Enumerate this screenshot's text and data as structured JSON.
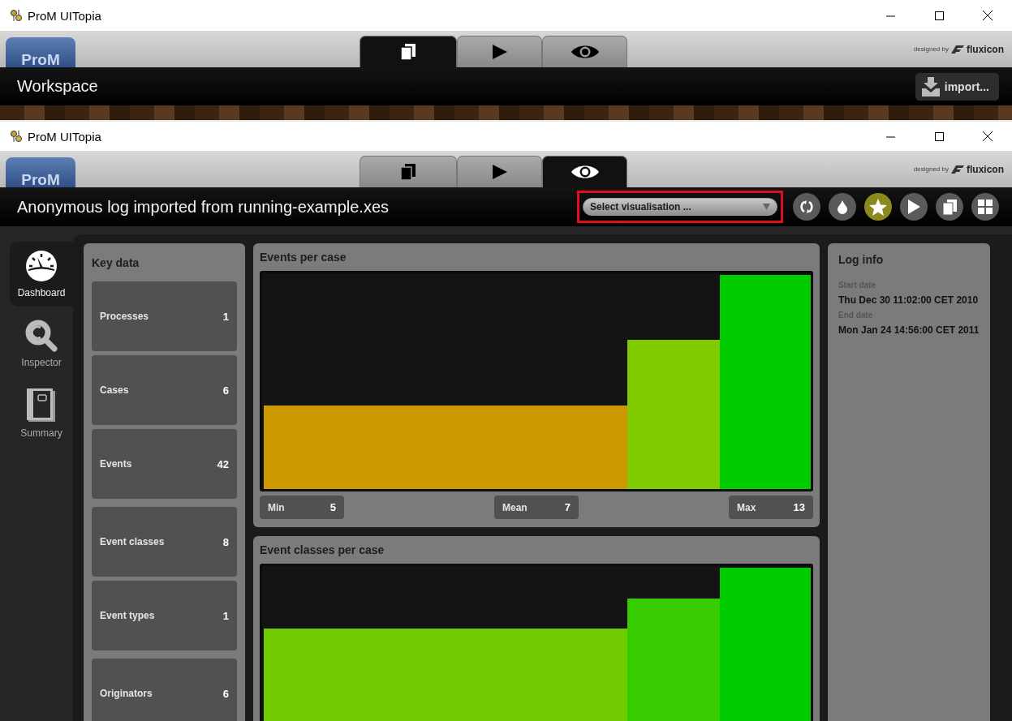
{
  "windows": [
    {
      "title": "ProM UITopia",
      "logo": "ProM",
      "credit": "designed by",
      "brand": "fluxicon",
      "heading": "Workspace",
      "tabs": [
        {
          "kind": "pages",
          "selected": true
        },
        {
          "kind": "play",
          "selected": false
        },
        {
          "kind": "eye",
          "selected": false
        }
      ],
      "import_button": "import..."
    },
    {
      "title": "ProM UITopia",
      "logo": "ProM",
      "credit": "designed by",
      "brand": "fluxicon",
      "heading": "Anonymous log imported from running-example.xes",
      "tabs": [
        {
          "kind": "pages",
          "selected": false
        },
        {
          "kind": "play",
          "selected": false
        },
        {
          "kind": "eye",
          "selected": true
        }
      ],
      "visualisation_select": {
        "placeholder": "Select visualisation ...",
        "highlighted": true
      },
      "toolbar": [
        {
          "kind": "refresh",
          "selected": false
        },
        {
          "kind": "drop",
          "selected": false
        },
        {
          "kind": "star",
          "selected": true
        },
        {
          "kind": "play",
          "selected": false
        },
        {
          "kind": "pages",
          "selected": false
        },
        {
          "kind": "grid",
          "selected": false
        }
      ]
    }
  ],
  "sidebar": [
    {
      "kind": "gauge",
      "label": "Dashboard",
      "selected": true
    },
    {
      "kind": "inspect",
      "label": "Inspector",
      "selected": false
    },
    {
      "kind": "book",
      "label": "Summary",
      "selected": false
    }
  ],
  "key_data": {
    "title": "Key data",
    "groups": [
      [
        {
          "label": "Processes",
          "value": "1"
        },
        {
          "label": "Cases",
          "value": "6"
        },
        {
          "label": "Events",
          "value": "42"
        }
      ],
      [
        {
          "label": "Event classes",
          "value": "8"
        },
        {
          "label": "Event types",
          "value": "1"
        }
      ],
      [
        {
          "label": "Originators",
          "value": "6"
        }
      ]
    ]
  },
  "charts": [
    {
      "title": "Events per case",
      "stats": [
        {
          "label": "Min",
          "value": "5"
        },
        {
          "label": "Mean",
          "value": "7"
        },
        {
          "label": "Max",
          "value": "13"
        }
      ]
    },
    {
      "title": "Event classes per case"
    }
  ],
  "log_info": {
    "title": "Log info",
    "fields": [
      {
        "label": "Start date",
        "value": "Thu Dec 30 11:02:00 CET 2010"
      },
      {
        "label": "End date",
        "value": "Mon Jan 24 14:56:00 CET 2011"
      }
    ]
  }
}
